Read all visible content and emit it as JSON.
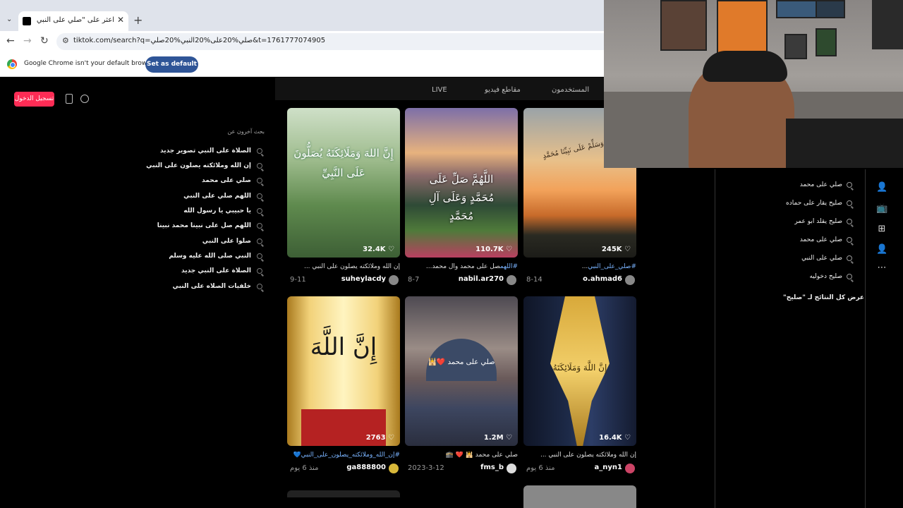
{
  "browser": {
    "tab_title": "اعثر على \"صلي على النبي صلي\"",
    "tab_close": "✕",
    "new_tab": "+",
    "tab_menu": "⌄",
    "url": "tiktok.com/search?q=صلي%20على%20النبي%20صلي&t=1761777074905",
    "infobar_message": "Google Chrome isn't your default browser",
    "set_default_label": "Set as default"
  },
  "tiktok": {
    "login_label": "تسجيل الدخول",
    "tabs": [
      "المستخدمون",
      "مقاطع فيديو",
      "LIVE"
    ],
    "others_searched_title": "بحث آخرون عن",
    "related_searches": [
      "الصلاة على النبي تصوير جديد",
      "إن الله وملائكته يصلون على النبي",
      "صلي على محمد",
      "اللهم صلي على النبي",
      "يا حبيبي يا رسول الله",
      "اللهم صل على نبينا محمد نبينا",
      "صلوا على النبي",
      "النبي صلى الله عليه وسلم",
      "الصلاة على النبي جديد",
      "خلفيات الصلاه على النبي"
    ],
    "videos": [
      {
        "likes": "32.4K",
        "caption_tag": "",
        "caption": "إن الله وملائكته يصلون على النبي ...",
        "user": "suheylacdy",
        "date": "9-11",
        "overlay": "إِنَّ اللهَ وَمَلَائِكَتَهُ يُصَلُّونَ عَلَى النَّبِيِّ"
      },
      {
        "likes": "110.7K",
        "caption_tag": "#اللهم",
        "caption": "صل على محمد وآل محمد...",
        "user": "nabil.ar270",
        "date": "8-7",
        "overlay": "اللَّهُمَّ صَلِّ عَلَى مُحَمَّدٍ وَعَلَى آلِ مُحَمَّدٍ"
      },
      {
        "likes": "245K",
        "caption_tag": "#صلي_على_النبي",
        "caption": "...",
        "user": "o.ahmad6",
        "date": "8-14",
        "overlay": "صَلِّ وَسَلِّمْ عَلَى نَبِيِّنَا مُحَمَّدٍ"
      },
      {
        "likes": "2763",
        "caption_tag": "#إن_الله_وملائكته_يصلون_على_النبي",
        "caption": "💙",
        "user": "ga888800",
        "date": "منذ 6 يوم",
        "overlay": "إِنَّ اللَّهَ"
      },
      {
        "likes": "1.2M",
        "caption_tag": "",
        "caption": "صلي على محمد 🕌 ❤️ 🕋",
        "user": "fms_b",
        "date": "2023-3-12",
        "overlay": "صلي على محمد ❤️🕌"
      },
      {
        "likes": "16.4K",
        "caption_tag": "",
        "caption": "إن الله وملائكته يصلون على النبي ...",
        "user": "a_nyn1",
        "date": "منذ 6 يوم",
        "overlay": "إِنَّ اللَّهَ وَمَلَائِكَتَهُ"
      }
    ],
    "suggestions": [
      "صلي على محمد",
      "صليح يقار على حماده",
      "صليح يقلد ابو عمر",
      "صلي على محمد",
      "صلي على النبي",
      "صليح دخوليه"
    ],
    "view_all_label": "عرض كل النتائج لـ \"صليح\""
  },
  "icons": [
    "back-icon",
    "forward-icon",
    "reload-icon",
    "tune-icon",
    "phone-icon",
    "compass-icon",
    "search-icon",
    "heart-icon",
    "follow-icon",
    "live-icon",
    "upload-icon",
    "profile-icon",
    "more-icon"
  ]
}
